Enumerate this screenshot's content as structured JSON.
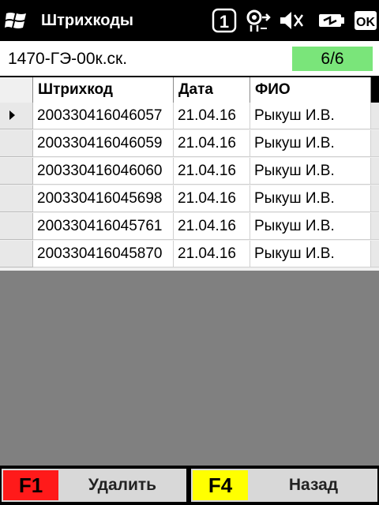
{
  "titlebar": {
    "title": "Штрихкоды",
    "notification_count": "1",
    "ok_label": "OK"
  },
  "header": {
    "doc_id": "1470-ГЭ-00к.ск.",
    "counter": "6/6"
  },
  "grid": {
    "columns": [
      "Штрихкод",
      "Дата",
      "ФИО"
    ],
    "rows": [
      {
        "barcode": "200330416046057",
        "date": "21.04.16",
        "name": "Рыкуш И.В."
      },
      {
        "barcode": "200330416046059",
        "date": "21.04.16",
        "name": "Рыкуш И.В."
      },
      {
        "barcode": "200330416046060",
        "date": "21.04.16",
        "name": "Рыкуш И.В."
      },
      {
        "barcode": "200330416045698",
        "date": "21.04.16",
        "name": "Рыкуш И.В."
      },
      {
        "barcode": "200330416045761",
        "date": "21.04.16",
        "name": "Рыкуш И.В."
      },
      {
        "barcode": "200330416045870",
        "date": "21.04.16",
        "name": "Рыкуш И.В."
      }
    ],
    "selected_row": 0
  },
  "footer": {
    "f1_key": "F1",
    "f1_label": "Удалить",
    "f1_color": "#ff1a1a",
    "f4_key": "F4",
    "f4_label": "Назад",
    "f4_color": "#ffff00"
  },
  "colors": {
    "counter_bg": "#7ae57a",
    "workspace_bg": "#808080"
  }
}
